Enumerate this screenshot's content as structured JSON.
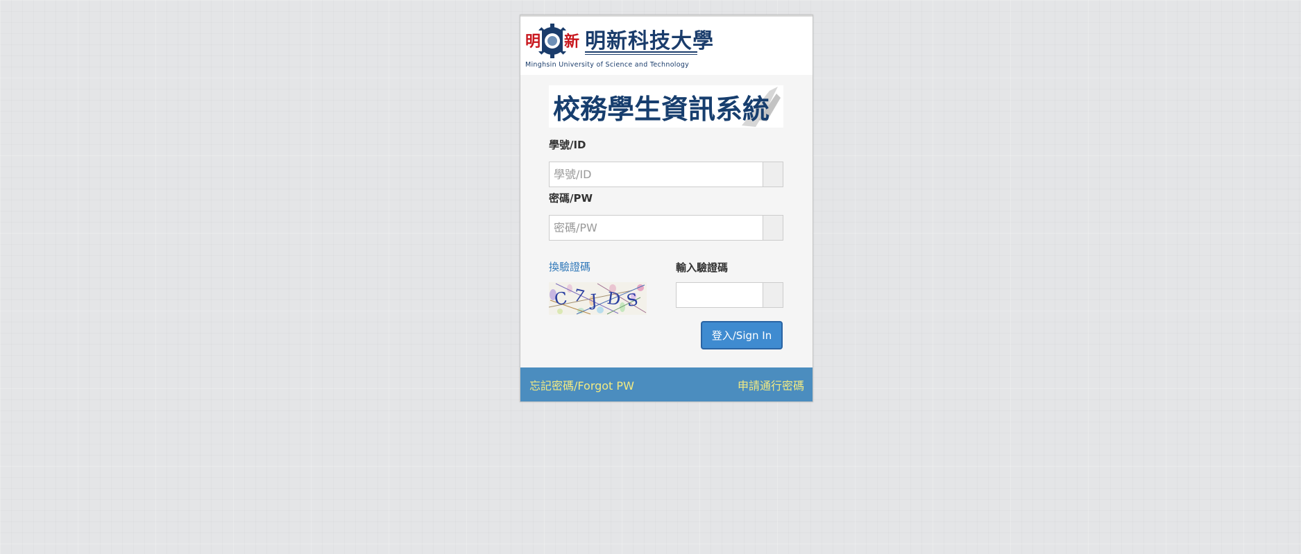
{
  "header": {
    "logo_seal_text_left": "明",
    "logo_seal_text_right": "新",
    "school_name_zh": "明新科技大學",
    "school_name_en": "Minghsin University of Science and Technology"
  },
  "system_title": "校務學生資訊系統",
  "form": {
    "id_label": "學號/ID",
    "id_placeholder": "學號/ID",
    "id_value": "",
    "pw_label": "密碼/PW",
    "pw_placeholder": "密碼/PW",
    "pw_value": "",
    "captcha_refresh_label": "換驗證碼",
    "captcha_input_label": "輸入驗證碼",
    "captcha_value": "",
    "captcha_text": "C7JDS",
    "signin_label": "登入/Sign In"
  },
  "footer": {
    "forgot_label": "忘記密碼/Forgot PW",
    "apply_label": "申請通行密碼"
  },
  "colors": {
    "accent": "#4b8dbf",
    "link": "#2f77b8",
    "footer_link": "#f3ea82",
    "button": "#3f8bd0"
  }
}
